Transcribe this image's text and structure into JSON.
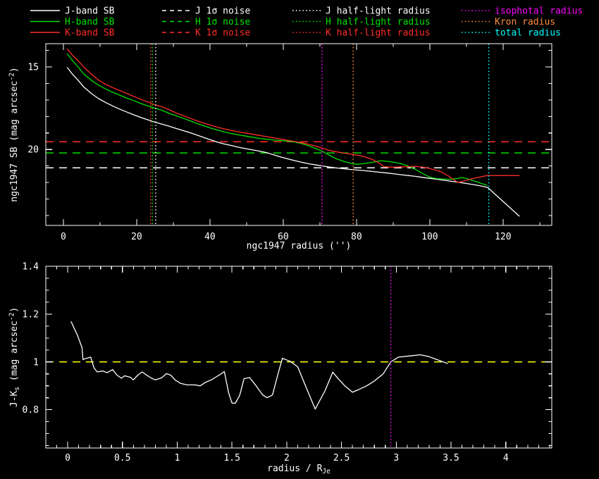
{
  "background": "#000000",
  "colors": {
    "white": "#ffffff",
    "green": "#00e100",
    "red": "#ff2d28",
    "magenta": "#ff00ff",
    "orange": "#ff8c3e",
    "cyan": "#00ffff",
    "yellow": "#ffff00"
  },
  "legend": {
    "columns": [
      {
        "items": [
          {
            "id": "j-band-sb",
            "label": "J-band SB",
            "color": "white",
            "style": "solid"
          },
          {
            "id": "h-band-sb",
            "label": "H-band SB",
            "color": "green",
            "style": "solid"
          },
          {
            "id": "k-band-sb",
            "label": "K-band SB",
            "color": "red",
            "style": "solid"
          }
        ]
      },
      {
        "items": [
          {
            "id": "j-noise",
            "label": "J 1σ noise",
            "color": "white",
            "style": "dashed"
          },
          {
            "id": "h-noise",
            "label": "H 1σ noise",
            "color": "green",
            "style": "dashed"
          },
          {
            "id": "k-noise",
            "label": "K 1σ noise",
            "color": "red",
            "style": "dashed"
          }
        ]
      },
      {
        "items": [
          {
            "id": "j-half-light",
            "label": "J half-light radius",
            "color": "white",
            "style": "dotted"
          },
          {
            "id": "h-half-light",
            "label": "H half-light radius",
            "color": "green",
            "style": "dotted"
          },
          {
            "id": "k-half-light",
            "label": "K half-light radius",
            "color": "red",
            "style": "dotted"
          }
        ]
      },
      {
        "items": [
          {
            "id": "isophotal-radius",
            "label": "isophotal radius",
            "color": "magenta",
            "style": "dotted"
          },
          {
            "id": "kron-radius",
            "label": "Kron radius",
            "color": "orange",
            "style": "dotted"
          },
          {
            "id": "total-radius",
            "label": "total radius",
            "color": "cyan",
            "style": "dotted"
          }
        ]
      }
    ]
  },
  "chart_data": [
    {
      "type": "line",
      "name": "surface-brightness-profile",
      "xlabel": "ngc1947 radius ('')",
      "xlabel_parts": [
        {
          "t": "ngc1947 radius ('')"
        }
      ],
      "ylabel": "ngc1947 SB (mag arcsec^-2)",
      "ylabel_parts": [
        {
          "t": "ngc1947 SB (mag arcsec"
        },
        {
          "t": "-2",
          "sup": true
        },
        {
          "t": ")"
        }
      ],
      "xlim": [
        -4.8,
        133.3
      ],
      "ylim": [
        13.59,
        24.6
      ],
      "y_axis_inverted_mag": true,
      "grid": false,
      "x_major_ticks": [
        {
          "v": 0,
          "label": "0"
        },
        {
          "v": 20,
          "label": "20"
        },
        {
          "v": 40,
          "label": "40"
        },
        {
          "v": 60,
          "label": "60"
        },
        {
          "v": 80,
          "label": "80"
        },
        {
          "v": 100,
          "label": "100"
        },
        {
          "v": 120,
          "label": "120"
        }
      ],
      "y_major_ticks": [
        {
          "v": 15,
          "label": "15"
        },
        {
          "v": 20,
          "label": "20"
        }
      ],
      "x_minor_step": 10,
      "y_minor_step": 1,
      "series": [
        {
          "id": "j-band-sb",
          "name": "J-band SB",
          "color": "white",
          "x": [
            1,
            2.5,
            4,
            5.5,
            7.7,
            9.6,
            11.5,
            13.4,
            15.3,
            17.2,
            19.2,
            21,
            23,
            25,
            27,
            29,
            30.7,
            32.6,
            34.5,
            36.4,
            38.3,
            40.2,
            42.1,
            44,
            46,
            48,
            50,
            51.7,
            53.6,
            55.6,
            57.5,
            59.4,
            61.3,
            63.2,
            65.2,
            67.1,
            69,
            71,
            72.8,
            74.7,
            76.6,
            78.5,
            80.4,
            82.3,
            84.3,
            86.2,
            88.5,
            90.4,
            92.3,
            94.2,
            96.1,
            98,
            100,
            102,
            104,
            106,
            108,
            110,
            112,
            114,
            115.8,
            120,
            124.5
          ],
          "y": [
            15.02,
            15.45,
            15.8,
            16.2,
            16.62,
            16.92,
            17.15,
            17.36,
            17.55,
            17.72,
            17.9,
            18.05,
            18.2,
            18.35,
            18.47,
            18.6,
            18.72,
            18.85,
            18.98,
            19.12,
            19.27,
            19.42,
            19.56,
            19.67,
            19.77,
            19.87,
            19.96,
            20.03,
            20.1,
            20.2,
            20.33,
            20.46,
            20.57,
            20.68,
            20.78,
            20.87,
            20.94,
            21.01,
            21.07,
            21.12,
            21.17,
            21.21,
            21.25,
            21.29,
            21.33,
            21.38,
            21.43,
            21.48,
            21.53,
            21.58,
            21.63,
            21.69,
            21.75,
            21.81,
            21.87,
            21.93,
            21.99,
            22.06,
            22.13,
            22.21,
            22.3,
            23.15,
            24.05
          ]
        },
        {
          "id": "h-band-sb",
          "name": "H-band SB",
          "color": "green",
          "x": [
            1,
            2.5,
            4,
            5.5,
            7.7,
            9.6,
            11.5,
            13.4,
            15.3,
            17.2,
            19.2,
            21,
            23,
            25,
            27,
            29,
            30.7,
            32.6,
            34.5,
            36.4,
            38.3,
            40.2,
            42.1,
            44,
            46,
            48,
            49.8,
            53.6,
            57.5,
            61.3,
            63.2,
            65.2,
            67.1,
            69,
            71,
            72.8,
            74.7,
            76.6,
            78.5,
            80.1,
            82,
            84.3,
            86.6,
            88.5,
            90.4,
            92,
            94,
            96,
            98,
            100,
            102,
            104,
            105.9,
            107.7,
            108.6,
            110,
            112,
            114,
            115.7
          ],
          "y": [
            14.19,
            14.62,
            15.0,
            15.42,
            15.82,
            16.1,
            16.33,
            16.53,
            16.7,
            16.88,
            17.04,
            17.2,
            17.36,
            17.5,
            17.64,
            17.82,
            17.95,
            18.1,
            18.26,
            18.42,
            18.56,
            18.7,
            18.83,
            18.94,
            19.04,
            19.12,
            19.19,
            19.33,
            19.43,
            19.49,
            19.55,
            19.65,
            19.79,
            19.95,
            20.15,
            20.38,
            20.58,
            20.73,
            20.84,
            20.9,
            20.85,
            20.78,
            20.68,
            20.72,
            20.78,
            20.85,
            21.0,
            21.2,
            21.45,
            21.68,
            21.77,
            21.8,
            21.8,
            21.76,
            21.7,
            21.76,
            21.9,
            22.05,
            22.18
          ]
        },
        {
          "id": "k-band-sb",
          "name": "K-band SB",
          "color": "red",
          "x": [
            1,
            2.5,
            4,
            5.5,
            7.7,
            9.6,
            11.5,
            13.4,
            15.3,
            17.2,
            19.2,
            21,
            23,
            25,
            27,
            29,
            30.7,
            32.6,
            34.5,
            36.4,
            38.3,
            40.2,
            42.1,
            44,
            46,
            48,
            49.8,
            53.6,
            57.5,
            61.3,
            65.2,
            69,
            71,
            72.8,
            74.7,
            76.6,
            78.5,
            80.4,
            82.3,
            84.3,
            86.2,
            87.5,
            90,
            93,
            95.8,
            97.7,
            100,
            102.9,
            105.2,
            107.7,
            110,
            112.5,
            115.7,
            120,
            124.5
          ],
          "y": [
            13.9,
            14.3,
            14.62,
            15.0,
            15.45,
            15.8,
            16.05,
            16.25,
            16.42,
            16.6,
            16.78,
            16.95,
            17.12,
            17.3,
            17.42,
            17.6,
            17.78,
            17.94,
            18.1,
            18.26,
            18.4,
            18.53,
            18.65,
            18.76,
            18.86,
            18.94,
            19.0,
            19.15,
            19.3,
            19.44,
            19.6,
            19.8,
            19.95,
            20.07,
            20.15,
            20.22,
            20.28,
            20.35,
            20.45,
            20.6,
            20.82,
            21.05,
            21.07,
            21.05,
            21.02,
            21.06,
            21.15,
            21.33,
            21.62,
            22.0,
            21.87,
            21.72,
            21.58,
            21.58,
            21.58
          ]
        }
      ],
      "h_ref_lines": [
        {
          "id": "k-noise-line",
          "name": "K 1σ noise",
          "color": "red",
          "style": "dashed",
          "y": 19.53
        },
        {
          "id": "h-noise-line",
          "name": "H 1σ noise",
          "color": "green",
          "style": "dashed",
          "y": 20.21
        },
        {
          "id": "j-noise-line",
          "name": "J 1σ noise",
          "color": "white",
          "style": "dashed",
          "y": 21.11
        }
      ],
      "v_ref_lines": [
        {
          "id": "k-half-light-line",
          "name": "K half-light radius",
          "color": "red",
          "style": "dotted",
          "x": 23.8
        },
        {
          "id": "h-half-light-line",
          "name": "H half-light radius",
          "color": "green",
          "style": "dotted",
          "x": 24.3
        },
        {
          "id": "j-half-light-line",
          "name": "J half-light radius",
          "color": "white",
          "style": "dotted",
          "x": 25.2
        },
        {
          "id": "isophotal-radius-line",
          "name": "isophotal radius",
          "color": "magenta",
          "style": "dotted",
          "x": 70.6
        },
        {
          "id": "kron-radius-line",
          "name": "Kron radius",
          "color": "orange",
          "style": "dotted",
          "x": 79.1
        },
        {
          "id": "total-radius-line",
          "name": "total radius",
          "color": "cyan",
          "style": "dotted",
          "x": 116.1
        }
      ]
    },
    {
      "type": "line",
      "name": "j-minus-ks-color-profile",
      "xlabel": "radius / R_Je",
      "xlabel_parts": [
        {
          "t": "radius / R"
        },
        {
          "t": "Je",
          "sub": true
        }
      ],
      "ylabel": "J-K_s (mag arcsec^-2)",
      "ylabel_parts": [
        {
          "t": "J-K"
        },
        {
          "t": "s",
          "sub": true
        },
        {
          "t": " (mag arcsec"
        },
        {
          "t": "-2",
          "sup": true
        },
        {
          "t": ")"
        }
      ],
      "xlim": [
        -0.2,
        4.42
      ],
      "ylim": [
        1.4,
        0.64
      ],
      "grid": false,
      "x_major_ticks": [
        {
          "v": 0,
          "label": "0"
        },
        {
          "v": 0.5,
          "label": "0.5"
        },
        {
          "v": 1,
          "label": "1"
        },
        {
          "v": 1.5,
          "label": "1.5"
        },
        {
          "v": 2,
          "label": "2"
        },
        {
          "v": 2.5,
          "label": "2.5"
        },
        {
          "v": 3,
          "label": "3"
        },
        {
          "v": 3.5,
          "label": "3.5"
        },
        {
          "v": 4,
          "label": "4"
        }
      ],
      "y_major_ticks": [
        {
          "v": 0.8,
          "label": "0.8"
        },
        {
          "v": 1,
          "label": "1"
        },
        {
          "v": 1.2,
          "label": "1.2"
        },
        {
          "v": 1.4,
          "label": "1.4"
        }
      ],
      "x_minor_step": 0.1,
      "y_minor_step": 0.05,
      "series": [
        {
          "id": "j-minus-ks",
          "name": "J-Ks",
          "color": "white",
          "x": [
            0.03,
            0.06,
            0.09,
            0.13,
            0.14,
            0.17,
            0.21,
            0.24,
            0.27,
            0.32,
            0.36,
            0.41,
            0.45,
            0.49,
            0.52,
            0.57,
            0.6,
            0.64,
            0.68,
            0.71,
            0.76,
            0.8,
            0.86,
            0.9,
            0.94,
            0.98,
            1.03,
            1.09,
            1.16,
            1.21,
            1.26,
            1.31,
            1.35,
            1.4,
            1.43,
            1.47,
            1.5,
            1.53,
            1.57,
            1.61,
            1.66,
            1.72,
            1.78,
            1.82,
            1.87,
            1.92,
            1.96,
            2.03,
            2.1,
            2.18,
            2.26,
            2.35,
            2.42,
            2.47,
            2.53,
            2.6,
            2.66,
            2.73,
            2.8,
            2.88,
            2.95,
            3.02,
            3.12,
            3.22,
            3.3,
            3.4,
            3.47
          ],
          "y": [
            1.17,
            1.14,
            1.11,
            1.06,
            1.01,
            1.015,
            1.02,
            0.975,
            0.958,
            0.962,
            0.955,
            0.968,
            0.945,
            0.932,
            0.942,
            0.936,
            0.925,
            0.945,
            0.958,
            0.948,
            0.933,
            0.925,
            0.934,
            0.951,
            0.945,
            0.925,
            0.91,
            0.904,
            0.904,
            0.9,
            0.915,
            0.925,
            0.936,
            0.95,
            0.96,
            0.87,
            0.828,
            0.827,
            0.86,
            0.93,
            0.935,
            0.9,
            0.862,
            0.85,
            0.862,
            0.95,
            1.015,
            1.003,
            0.98,
            0.89,
            0.803,
            0.88,
            0.957,
            0.93,
            0.9,
            0.873,
            0.885,
            0.9,
            0.92,
            0.95,
            1.0,
            1.02,
            1.025,
            1.03,
            1.022,
            1.005,
            0.993
          ]
        }
      ],
      "h_ref_lines": [
        {
          "id": "jk-unity-line",
          "name": "J-Ks = 1",
          "color": "yellow",
          "style": "dashed",
          "y": 1.0
        }
      ],
      "v_ref_lines": [
        {
          "id": "isophotal-radius-line-bottom",
          "name": "isophotal radius",
          "color": "magenta",
          "style": "dotted",
          "x": 2.95
        }
      ]
    }
  ]
}
